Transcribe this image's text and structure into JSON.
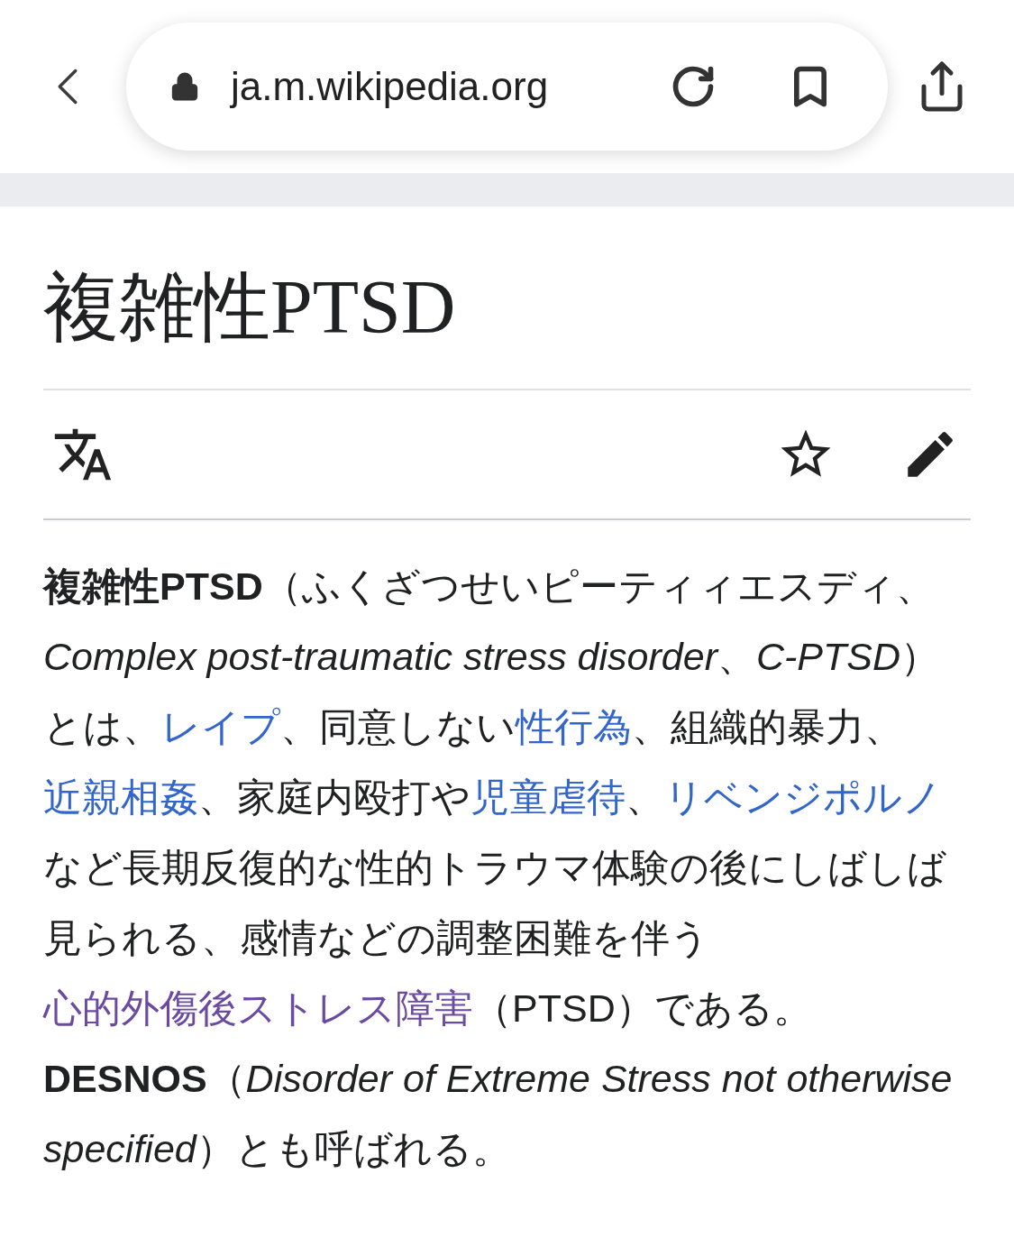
{
  "browser": {
    "url": "ja.m.wikipedia.org"
  },
  "article": {
    "title": "複雑性PTSD"
  },
  "paragraph": [
    {
      "kind": "bold",
      "text": "複雑性PTSD"
    },
    {
      "kind": "text",
      "text": "（ふくざつせいピーティィエスディ、"
    },
    {
      "kind": "italic",
      "text": "Complex post-traumatic stress disorder"
    },
    {
      "kind": "text",
      "text": "、"
    },
    {
      "kind": "italic",
      "text": "C-PTSD"
    },
    {
      "kind": "text",
      "text": "）とは、"
    },
    {
      "kind": "link",
      "text": "レイプ",
      "visited": false
    },
    {
      "kind": "text",
      "text": "、同意しない"
    },
    {
      "kind": "link",
      "text": "性行為",
      "visited": false
    },
    {
      "kind": "text",
      "text": "、組織的暴力、"
    },
    {
      "kind": "link",
      "text": "近親相姦",
      "visited": false
    },
    {
      "kind": "text",
      "text": "、家庭内殴打や"
    },
    {
      "kind": "link",
      "text": "児童虐待",
      "visited": false
    },
    {
      "kind": "text",
      "text": "、"
    },
    {
      "kind": "link",
      "text": "リベンジポルノ",
      "visited": false
    },
    {
      "kind": "text",
      "text": "など長期反復的な性的トラウマ体験の後にしばしば見られる、感情などの調整困難を伴う"
    },
    {
      "kind": "link",
      "text": "心的外傷後ストレス障害",
      "visited": true
    },
    {
      "kind": "text",
      "text": "（PTSD）である。"
    },
    {
      "kind": "bold",
      "text": "DESNOS"
    },
    {
      "kind": "text",
      "text": "（"
    },
    {
      "kind": "italic",
      "text": "Disorder of Extreme Stress not otherwise specified"
    },
    {
      "kind": "text",
      "text": "）とも呼ばれる。"
    }
  ]
}
